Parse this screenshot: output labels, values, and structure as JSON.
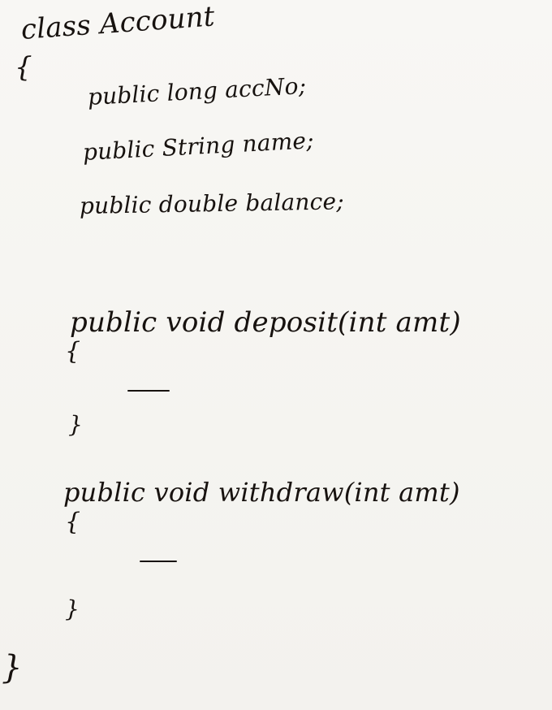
{
  "code": {
    "class_header": "class Account",
    "class_open_brace": "{",
    "fields": [
      "public long accNo;",
      "public String name;",
      "public double balance;"
    ],
    "methods": [
      {
        "signature": "public void deposit(int amt)",
        "open_brace": "{",
        "body_placeholder": "—",
        "close_brace": "}"
      },
      {
        "signature": "public void withdraw(int amt)",
        "open_brace": "{",
        "body_placeholder": "—",
        "close_brace": "}"
      }
    ],
    "class_close_brace": "}"
  }
}
